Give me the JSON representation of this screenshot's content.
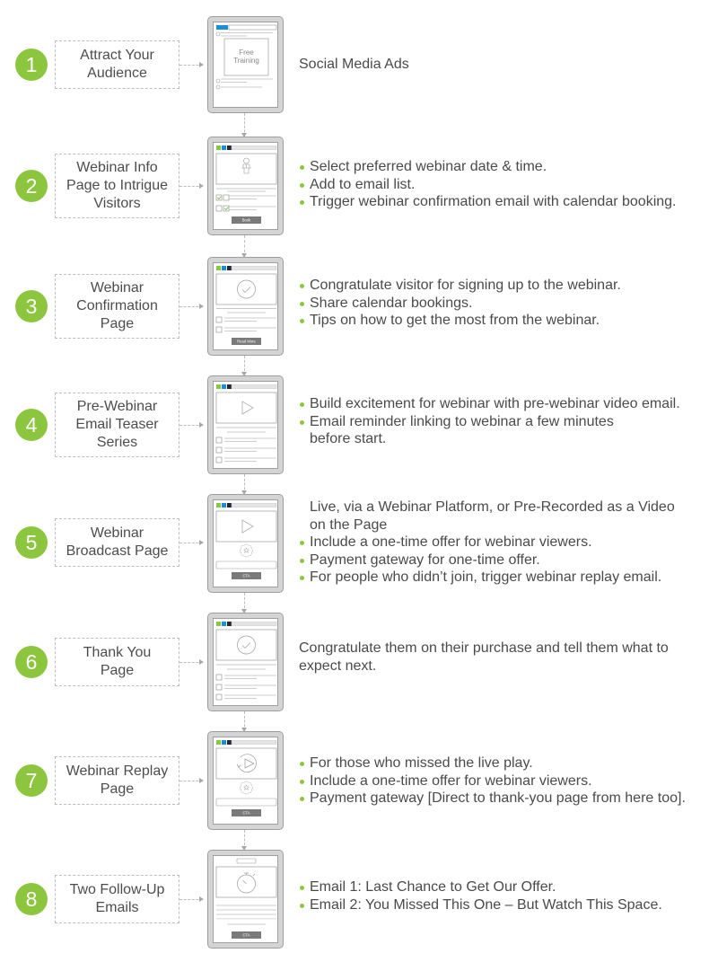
{
  "accent_color": "#8cc63f",
  "steps": [
    {
      "number": "1",
      "title_lines": [
        "Attract Your",
        "Audience"
      ],
      "mockup": "social-ad",
      "mockup_text": [
        "Free",
        "Training"
      ],
      "description_intro": [
        "Social Media Ads"
      ],
      "bullets": []
    },
    {
      "number": "2",
      "title_lines": [
        "Webinar Info",
        "Page to Intrigue",
        "Visitors"
      ],
      "mockup": "info-page",
      "mockup_button": "Book",
      "description_intro": [],
      "bullets": [
        "Select preferred webinar date & time.",
        "Add to email list.",
        "Trigger webinar confirmation email with calendar booking."
      ]
    },
    {
      "number": "3",
      "title_lines": [
        "Webinar",
        "Confirmation",
        "Page"
      ],
      "mockup": "confirmation-page",
      "mockup_button": "Read More",
      "description_intro": [],
      "bullets": [
        "Congratulate visitor for signing up to the webinar.",
        "Share calendar bookings.",
        "Tips on how to get the most from the webinar."
      ]
    },
    {
      "number": "4",
      "title_lines": [
        "Pre-Webinar",
        "Email Teaser",
        "Series"
      ],
      "mockup": "video-email",
      "description_intro": [],
      "bullets": [
        "Build excitement for webinar with pre-webinar video email.",
        "Email reminder linking to webinar a few minutes\nbefore start."
      ]
    },
    {
      "number": "5",
      "title_lines": [
        "Webinar",
        "Broadcast Page"
      ],
      "mockup": "broadcast-page",
      "mockup_button": "CTA",
      "description_intro": [
        "Live, via a Webinar Platform, or Pre-Recorded as a Video",
        "on the Page"
      ],
      "bullets": [
        "Include a one-time offer for webinar viewers.",
        "Payment gateway for one-time offer.",
        "For people who didn’t join, trigger webinar replay email."
      ]
    },
    {
      "number": "6",
      "title_lines": [
        "Thank You",
        "Page"
      ],
      "mockup": "thank-you-page",
      "description_intro": [
        "Congratulate them on their purchase and tell them what to",
        "expect next."
      ],
      "bullets": []
    },
    {
      "number": "7",
      "title_lines": [
        "Webinar Replay",
        "Page"
      ],
      "mockup": "replay-page",
      "mockup_button": "CTA",
      "description_intro": [],
      "bullets": [
        "For those who missed the live play.",
        "Include a one-time offer for webinar viewers.",
        "Payment gateway [Direct to thank-you page from here too]."
      ]
    },
    {
      "number": "8",
      "title_lines": [
        "Two Follow-Up",
        "Emails"
      ],
      "mockup": "follow-up-email",
      "mockup_button": "CTA",
      "description_intro": [],
      "bullets": [
        "Email 1: Last Chance to Get Our Offer.",
        "Email 2: You Missed This One – But Watch This Space."
      ]
    }
  ]
}
